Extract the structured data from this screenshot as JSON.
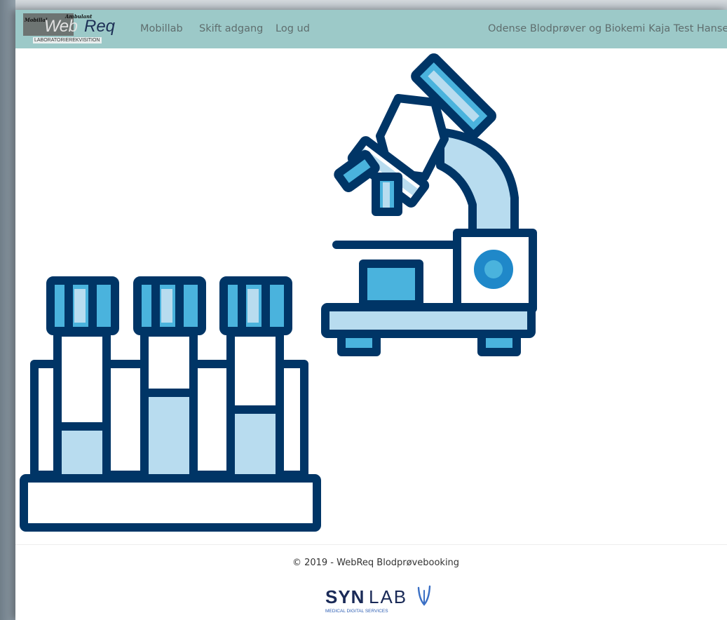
{
  "logo": {
    "text_top_left": "Mobillal",
    "text_top_right": "Ambulant",
    "text_web": "Web",
    "text_req": "Req",
    "subtitle": "LABORATORIEREKVISITION"
  },
  "nav": {
    "items": [
      {
        "label": "Mobillab"
      },
      {
        "label": "Skift adgang"
      },
      {
        "label": "Log ud"
      }
    ],
    "user": "Odense Blodprøver og Biokemi Kaja Test Hansen"
  },
  "colors": {
    "navbar": "#9cc9c8",
    "illustration_dark": "#003566",
    "illustration_mid": "#4ab3dd",
    "illustration_light": "#b8dcef",
    "synlab_navy": "#1a2a57"
  },
  "hero": {
    "icons": [
      "microscope-icon",
      "test-tubes-icon"
    ]
  },
  "footer": {
    "copyright": "© 2019 - WebReq Blodprøvebooking",
    "brand_bold": "SYN",
    "brand_light": "LAB",
    "brand_tagline": "MEDICAL DIGITAL SERVICES"
  }
}
